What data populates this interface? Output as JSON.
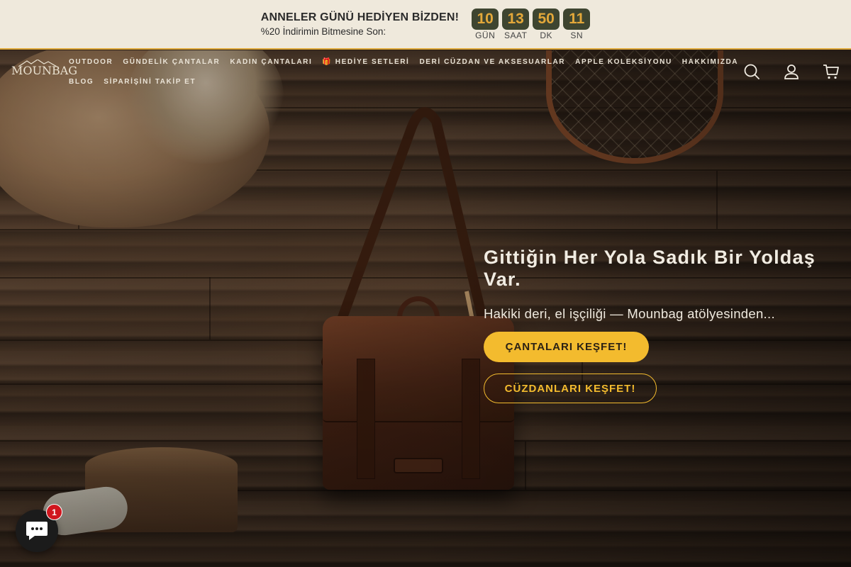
{
  "announcement": {
    "title": "ANNELER GÜNÜ HEDİYEN BİZDEN!",
    "subtitle": "%20 İndirimin Bitmesine Son:",
    "countdown": [
      {
        "value": "10",
        "label": "GÜN"
      },
      {
        "value": "13",
        "label": "SAAT"
      },
      {
        "value": "50",
        "label": "DK"
      },
      {
        "value": "11",
        "label": "SN"
      }
    ]
  },
  "header": {
    "logo_text": "MOUNBAG",
    "nav_row1": [
      "OUTDOOR",
      "GÜNDELİK ÇANTALAR",
      "KADIN ÇANTALARI",
      "🎁 HEDİYE SETLERİ",
      "DERİ CÜZDAN VE AKSESUARLAR",
      "APPLE KOLEKSİYONU",
      "HAKKIMIZDA"
    ],
    "nav_row2": [
      "BLOG",
      "SİPARİŞİNİ TAKİP ET"
    ],
    "icons": [
      "search-icon",
      "account-icon",
      "cart-icon"
    ]
  },
  "hero": {
    "title": "Gittiğin Her Yola Sadık Bir Yoldaş Var.",
    "subtitle": "Hakiki deri, el işçiliği — Mounbag atölyesinden...",
    "primary_button": "ÇANTALARI KEŞFET!",
    "secondary_button": "CÜZDANLARI KEŞFET!"
  },
  "chat": {
    "badge_count": "1"
  },
  "colors": {
    "accent": "#f3bb2e",
    "announce_bg": "#efe9dc",
    "countdown_bg": "#3e4530",
    "countdown_text": "#e3a83a"
  }
}
